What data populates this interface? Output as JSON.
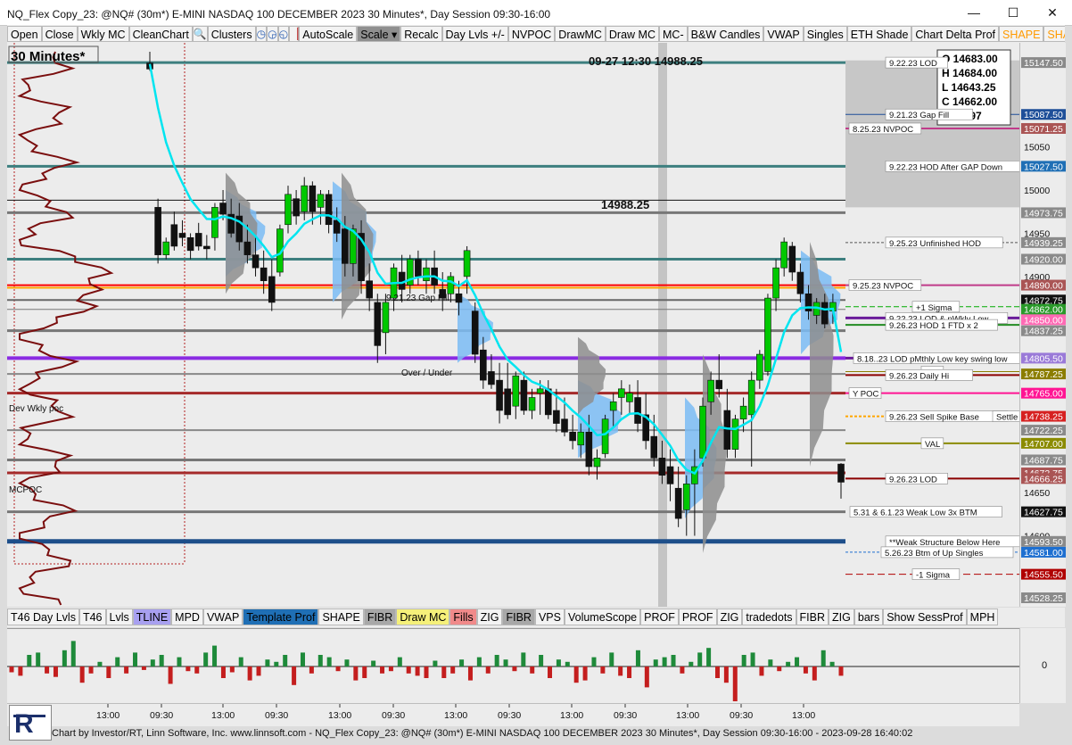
{
  "window": {
    "title": "NQ_Flex Copy_23: @NQ# (30m*) E-MINI NASDAQ 100 DECEMBER 2023 30 Minutes*, Day Session 09:30-16:00",
    "minimize": "—",
    "maximize": "☐",
    "close": "✕"
  },
  "toolbar": {
    "buttons": [
      "Open",
      "Close",
      "Wkly MC",
      "CleanChart"
    ],
    "clusters": "Clusters",
    "buttons2": [
      "AutoScale",
      "Scale ▾",
      "Recalc",
      "Day Lvls +/-",
      "NVPOC",
      "DrawMC",
      "Draw MC",
      "MC-",
      "B&W Candles",
      "VWAP",
      "Singles",
      "ETH Shade",
      "Chart Delta Prof",
      "SHAPE",
      "SHA"
    ]
  },
  "bottom_toolbar": [
    "T46 Day Lvls",
    "T46",
    "Lvls",
    "TLINE",
    "MPD",
    "VWAP",
    "Template Prof",
    "SHAPE",
    "FIBR",
    "Draw MC",
    "Fills",
    "ZIG",
    "FIBR",
    "VPS",
    "VolumeScope",
    "PROF",
    "PROF",
    "ZIG",
    "tradedots",
    "FIBR",
    "ZIG",
    "bars",
    "Show SessProf",
    "MPH"
  ],
  "colors": {
    "bull": "#00c800",
    "bear": "#111111",
    "vwap": "#00e5f0",
    "profile_blue": "#7bbcf5",
    "profile_gray": "#8e8e8e"
  },
  "chart_data": {
    "type": "candlestick",
    "period_label": "30 Minutes*",
    "header_label": "09-27 12:30  14988.25",
    "cursor_price_label": "14988.25",
    "ohlc_box": {
      "O": "14683.00",
      "H": "14684.00",
      "L": "14643.25",
      "C": "14662.00",
      "V": "35997"
    },
    "ylim": [
      14520,
      15160
    ],
    "price_ticks": [
      "15147.50",
      "15087.50",
      "15071.25",
      "15050",
      "15027.50",
      "15000",
      "14973.75",
      "14950",
      "14939.25",
      "14920.00",
      "14900",
      "14890.00",
      "14872.75",
      "14862.00",
      "14850.00",
      "14837.25",
      "14805.50",
      "14787.25",
      "14765.00",
      "14738.25",
      "14722.25",
      "14707.00",
      "14687.75",
      "14672.75",
      "14666.25",
      "14650",
      "14627.75",
      "14600",
      "14593.50",
      "14581.00",
      "14555.50",
      "14528.25"
    ],
    "level_labels": [
      {
        "text": "9.22.23 LOD",
        "price": 15147.5
      },
      {
        "text": "9.21.23 Gap Fill",
        "price": 15087.5
      },
      {
        "text": "8.25.23 NVPOC",
        "price": 15071.25
      },
      {
        "text": "9.22.23 HOD After GAP Down",
        "price": 15027.5
      },
      {
        "text": "9.25.23 Unfinished HOD",
        "price": 14939.25
      },
      {
        "text": "9.25.23 NVPOC",
        "price": 14890.0
      },
      {
        "text": "+1 Sigma",
        "price": 14865
      },
      {
        "text": "9.22.23 LOD & pWkly Low",
        "price": 14852
      },
      {
        "text": "9.26.23 HOD 1 FTD x 2",
        "price": 14844
      },
      {
        "text": "8.18..23 LOD pMthly Low key swing low",
        "price": 14805.5
      },
      {
        "text": "VAH",
        "price": 14790
      },
      {
        "text": "9.26.23 Daily Hi",
        "price": 14786
      },
      {
        "text": "Y POC",
        "price": 14765.0
      },
      {
        "text": "9.26.23 Sell Spike Base",
        "price": 14738.25
      },
      {
        "text": "Settle",
        "price": 14738.25
      },
      {
        "text": "VAL",
        "price": 14707.0
      },
      {
        "text": "9.26.23 LOD",
        "price": 14666.25
      },
      {
        "text": "5.31 & 6.1.23 Weak Low 3x BTM",
        "price": 14627.75
      },
      {
        "text": "**Weak Structure Below Here",
        "price": 14593.5
      },
      {
        "text": "5.26.23 Btm of Up Singles",
        "price": 14581.0
      },
      {
        "text": "-1 Sigma",
        "price": 14555.5
      }
    ],
    "chart_texts": [
      "Dev Wkly poc",
      "MCPOC",
      "Over / Under",
      "9.21.23 Gap Fill",
      "VAH"
    ],
    "time_ticks": [
      "13:00",
      "09:30",
      "13:00",
      "09:30",
      "13:00",
      "09:30",
      "13:00",
      "09:30",
      "13:00",
      "09:30",
      "13:00",
      "09:30",
      "13:00"
    ],
    "candles": [
      [
        15147,
        15160,
        15138,
        15140
      ],
      [
        14980,
        14990,
        14915,
        14925
      ],
      [
        14925,
        14945,
        14920,
        14940
      ],
      [
        14960,
        14975,
        14930,
        14935
      ],
      [
        14950,
        14965,
        14935,
        14945
      ],
      [
        14945,
        14950,
        14920,
        14930
      ],
      [
        14950,
        14962,
        14930,
        14935
      ],
      [
        14935,
        14948,
        14920,
        14932
      ],
      [
        14945,
        14985,
        14930,
        14980
      ],
      [
        14985,
        15000,
        14965,
        14972
      ],
      [
        14972,
        14990,
        14945,
        14950
      ],
      [
        14970,
        14985,
        14930,
        14940
      ],
      [
        14940,
        14960,
        14915,
        14925
      ],
      [
        14925,
        14945,
        14900,
        14910
      ],
      [
        14910,
        14930,
        14880,
        14895
      ],
      [
        14900,
        14920,
        14860,
        14870
      ],
      [
        14905,
        14960,
        14900,
        14955
      ],
      [
        14960,
        15005,
        14950,
        14995
      ],
      [
        14990,
        15000,
        14960,
        14970
      ],
      [
        14975,
        15015,
        14965,
        15005
      ],
      [
        15005,
        15010,
        14960,
        14975
      ],
      [
        14980,
        15000,
        14960,
        14995
      ],
      [
        14995,
        15000,
        14950,
        14960
      ],
      [
        14965,
        14980,
        14940,
        14950
      ],
      [
        14955,
        14970,
        14900,
        14915
      ],
      [
        14915,
        14960,
        14900,
        14955
      ],
      [
        14950,
        14965,
        14880,
        14895
      ],
      [
        14895,
        14915,
        14860,
        14875
      ],
      [
        14870,
        14880,
        14800,
        14820
      ],
      [
        14835,
        14880,
        14810,
        14870
      ],
      [
        14875,
        14915,
        14860,
        14910
      ],
      [
        14905,
        14925,
        14870,
        14885
      ],
      [
        14890,
        14925,
        14880,
        14920
      ],
      [
        14920,
        14930,
        14890,
        14900
      ],
      [
        14895,
        14920,
        14880,
        14910
      ],
      [
        14910,
        14930,
        14880,
        14890
      ],
      [
        14885,
        14905,
        14860,
        14875
      ],
      [
        14880,
        14905,
        14870,
        14900
      ],
      [
        14880,
        14895,
        14855,
        14870
      ],
      [
        14900,
        14935,
        14880,
        14930
      ],
      [
        14860,
        14870,
        14800,
        14810
      ],
      [
        14815,
        14830,
        14770,
        14780
      ],
      [
        14790,
        14810,
        14770,
        14775
      ],
      [
        14780,
        14800,
        14730,
        14745
      ],
      [
        14770,
        14800,
        14735,
        14740
      ],
      [
        14750,
        14790,
        14735,
        14785
      ],
      [
        14780,
        14790,
        14740,
        14745
      ],
      [
        14745,
        14770,
        14735,
        14760
      ],
      [
        14765,
        14780,
        14740,
        14770
      ],
      [
        14770,
        14780,
        14735,
        14740
      ],
      [
        14745,
        14770,
        14720,
        14730
      ],
      [
        14735,
        14760,
        14715,
        14720
      ],
      [
        14720,
        14740,
        14700,
        14710
      ],
      [
        14705,
        14730,
        14690,
        14720
      ],
      [
        14720,
        14740,
        14670,
        14680
      ],
      [
        14680,
        14700,
        14665,
        14690
      ],
      [
        14695,
        14740,
        14690,
        14735
      ],
      [
        14745,
        14765,
        14725,
        14755
      ],
      [
        14760,
        14780,
        14740,
        14770
      ],
      [
        14755,
        14775,
        14740,
        14765
      ],
      [
        14760,
        14780,
        14720,
        14730
      ],
      [
        14740,
        14765,
        14700,
        14710
      ],
      [
        14715,
        14740,
        14680,
        14690
      ],
      [
        14690,
        14710,
        14660,
        14670
      ],
      [
        14680,
        14700,
        14640,
        14660
      ],
      [
        14655,
        14680,
        14610,
        14620
      ],
      [
        14630,
        14670,
        14600,
        14660
      ],
      [
        14660,
        14700,
        14600,
        14680
      ],
      [
        14690,
        14760,
        14680,
        14750
      ],
      [
        14755,
        14790,
        14740,
        14780
      ],
      [
        14780,
        14810,
        14760,
        14770
      ],
      [
        14745,
        14770,
        14690,
        14700
      ],
      [
        14700,
        14740,
        14690,
        14735
      ],
      [
        14735,
        14760,
        14720,
        14750
      ],
      [
        14740,
        14790,
        14680,
        14780
      ],
      [
        14780,
        14815,
        14770,
        14810
      ],
      [
        14790,
        14880,
        14785,
        14875
      ],
      [
        14875,
        14920,
        14860,
        14910
      ],
      [
        14910,
        14945,
        14900,
        14940
      ],
      [
        14935,
        14940,
        14895,
        14905
      ],
      [
        14905,
        14915,
        14870,
        14880
      ],
      [
        14880,
        14890,
        14850,
        14860
      ],
      [
        14855,
        14875,
        14845,
        14870
      ],
      [
        14870,
        14880,
        14840,
        14845
      ],
      [
        14860,
        14880,
        14845,
        14870
      ],
      [
        14683,
        14684,
        14643,
        14662
      ]
    ],
    "delta_bars": [
      -5,
      -8,
      10,
      12,
      -6,
      -9,
      14,
      22,
      -14,
      -6,
      4,
      -10,
      8,
      -6,
      12,
      -3,
      6,
      10,
      -15,
      8,
      -4,
      -6,
      12,
      18,
      -10,
      -5,
      8,
      -12,
      -8,
      6,
      4,
      10,
      -16,
      12,
      -6,
      10,
      8,
      -4,
      6,
      -12,
      -10,
      5,
      -6,
      -4,
      8,
      -6,
      -8,
      -10,
      5,
      -10,
      -6,
      6,
      -12,
      8,
      -6,
      10,
      6,
      -4,
      12,
      -6,
      10,
      -10,
      6,
      4,
      -14,
      -12,
      8,
      -6,
      12,
      -8,
      -10,
      14,
      -18,
      6,
      8,
      10,
      -6,
      4,
      12,
      16,
      -10,
      -14,
      -30,
      10,
      12,
      -8,
      6,
      -4,
      4,
      8,
      -6,
      -12,
      14,
      4,
      -8
    ]
  },
  "footer": "Chart by Investor/RT, Linn Software, Inc. www.linnsoft.com - NQ_Flex Copy_23: @NQ# (30m*) E-MINI NASDAQ 100 DECEMBER 2023 30 Minutes*, Day Session 09:30-16:00 - 2023-09-28 16:40:02"
}
